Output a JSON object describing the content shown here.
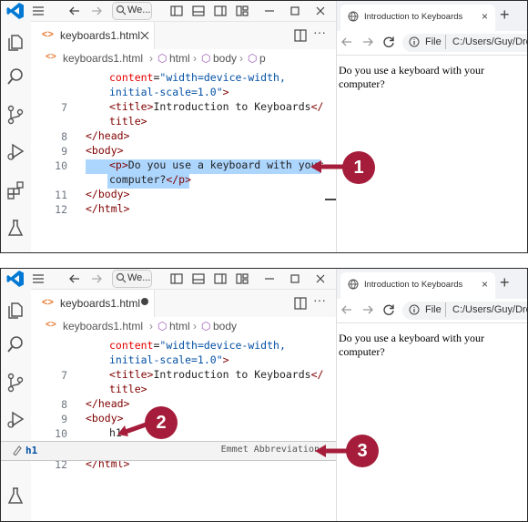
{
  "top_bar": {
    "search_text": "We..."
  },
  "panel1": {
    "tab_label": "keyboards1.html",
    "breadcrumbs": [
      "keyboards1.html",
      "html",
      "body",
      "p"
    ],
    "lines": [
      {
        "num": "",
        "parts": [
          [
            "at",
            "content"
          ],
          [
            "tx",
            "="
          ],
          [
            "av",
            "\"width=device-width,"
          ]
        ]
      },
      {
        "num": "",
        "parts": [
          [
            "av",
            "initial-scale=1.0\""
          ],
          [
            "tg",
            ">"
          ]
        ]
      },
      {
        "num": "7",
        "parts": [
          [
            "tg",
            "<title>"
          ],
          [
            "tx",
            "Introduction to Keyboards"
          ],
          [
            "tg",
            "</"
          ]
        ]
      },
      {
        "num": "",
        "parts": [
          [
            "tg",
            "title>"
          ]
        ]
      },
      {
        "num": "8",
        "parts": [
          [
            "tg",
            "</head>"
          ]
        ]
      },
      {
        "num": "9",
        "parts": [
          [
            "tg",
            "<body>"
          ]
        ]
      },
      {
        "num": "10",
        "parts": [
          [
            "tg",
            "<p>"
          ],
          [
            "tx",
            "Do you use a keyboard with your"
          ]
        ]
      },
      {
        "num": "",
        "parts": [
          [
            "tx",
            "computer?"
          ],
          [
            "tg",
            "</p>"
          ]
        ]
      },
      {
        "num": "11",
        "parts": [
          [
            "tg",
            "</body>"
          ]
        ]
      },
      {
        "num": "12",
        "parts": [
          [
            "tg",
            "</html>"
          ]
        ]
      }
    ],
    "callout": "1"
  },
  "panel2": {
    "tab_label": "keyboards1.html",
    "breadcrumbs": [
      "keyboards1.html",
      "html",
      "body"
    ],
    "lines": [
      {
        "num": "",
        "parts": [
          [
            "at",
            "content"
          ],
          [
            "tx",
            "="
          ],
          [
            "av",
            "\"width=device-width,"
          ]
        ]
      },
      {
        "num": "",
        "parts": [
          [
            "av",
            "initial-scale=1.0\""
          ],
          [
            "tg",
            ">"
          ]
        ]
      },
      {
        "num": "7",
        "parts": [
          [
            "tg",
            "<title>"
          ],
          [
            "tx",
            "Introduction to Keyboards"
          ],
          [
            "tg",
            "</"
          ]
        ]
      },
      {
        "num": "",
        "parts": [
          [
            "tg",
            "title>"
          ]
        ]
      },
      {
        "num": "8",
        "parts": [
          [
            "tg",
            "</head>"
          ]
        ]
      },
      {
        "num": "9",
        "parts": [
          [
            "tg",
            "<body>"
          ]
        ]
      },
      {
        "num": "10",
        "parts": [
          [
            "tx",
            "h1"
          ]
        ]
      },
      {
        "num": "12",
        "parts": [
          [
            "tg",
            "</html>"
          ]
        ]
      }
    ],
    "suggestion": {
      "label": "h1",
      "detail": "Emmet Abbreviation"
    },
    "callouts": [
      "2",
      "3"
    ]
  },
  "browser": {
    "tab_title": "Introduction to Keyboards",
    "file_label": "File",
    "address": "C:/Users/Guy/Dro...",
    "page_text": "Do you use a keyboard with your computer?"
  },
  "accent": "#a51d3a",
  "selection_color": "#add6ff"
}
